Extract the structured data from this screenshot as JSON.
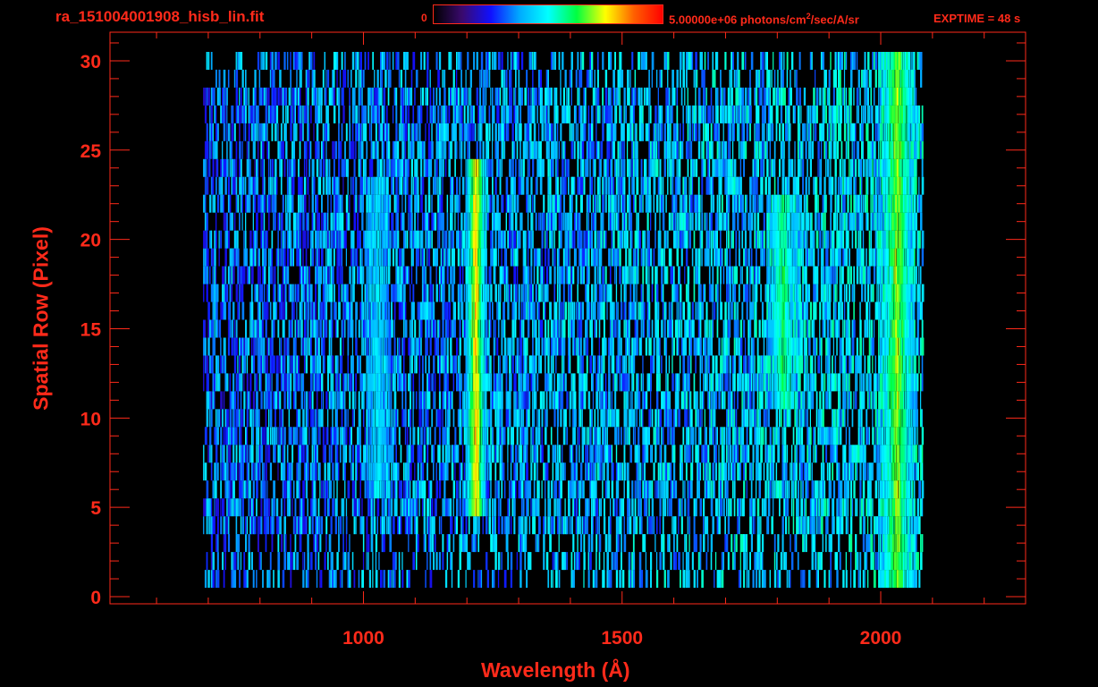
{
  "header": {
    "file_title": "ra_151004001908_hisb_lin.fit",
    "colorbar_min": "0",
    "colorbar_max_prefix": "5.00000e+06 photons/cm",
    "colorbar_max_sup": "2",
    "colorbar_max_suffix": "/sec/A/sr",
    "exptime": "EXPTIME = 48 s"
  },
  "colors": {
    "axis": "#ff2a1a",
    "background": "#000000",
    "colormap": [
      "#000000",
      "#3a0a6e",
      "#1010ff",
      "#00aaff",
      "#00ffff",
      "#00ff40",
      "#ffff00",
      "#ff6000",
      "#ff0000"
    ]
  },
  "chart_data": {
    "type": "heatmap",
    "title": "ra_151004001908_hisb_lin.fit",
    "xlabel": "Wavelength (Å)",
    "ylabel": "Spatial Row (Pixel)",
    "xlim": [
      510,
      2280
    ],
    "ylim": [
      -0.4,
      31.6
    ],
    "xticks": [
      1000,
      1500,
      2000
    ],
    "yticks": [
      0,
      5,
      10,
      15,
      20,
      25,
      30
    ],
    "colorbar_range": [
      0,
      5000000
    ],
    "colorbar_units": "photons/cm2/sec/A/sr",
    "data_extent": {
      "x": [
        690,
        2080
      ],
      "y": [
        1,
        30
      ]
    },
    "features": [
      {
        "wavelength": 1216,
        "rows": [
          5,
          24
        ],
        "level": 0.8
      },
      {
        "wavelength": 1026,
        "rows": [
          6,
          23
        ],
        "level": 0.45
      },
      {
        "wavelength": 1810,
        "rows": [
          11,
          22
        ],
        "level": 0.6
      },
      {
        "wavelength": 2030,
        "rows": [
          1,
          30
        ],
        "level": 0.7
      }
    ]
  }
}
